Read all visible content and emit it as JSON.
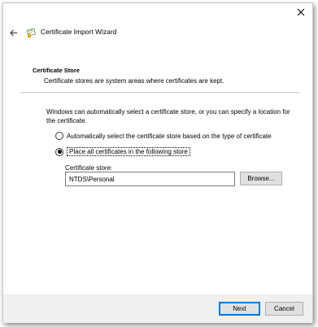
{
  "wizard": {
    "title": "Certificate Import Wizard",
    "back_icon": "arrow-left-icon",
    "close_icon": "close-icon",
    "certificate_icon": "certificate-icon"
  },
  "header": {
    "section_title": "Certificate Store",
    "section_description": "Certificate stores are system areas where certificates are kept."
  },
  "body": {
    "intro_text": "Windows can automatically select a certificate store, or you can specify a location for the certificate.",
    "radio_auto": {
      "label": "Automatically select the certificate store based on the type of certificate",
      "selected": false
    },
    "radio_manual": {
      "label": "Place all certificates in the following store",
      "selected": true
    },
    "store_label": "Certificate store:",
    "store_value": "NTDS\\Personal",
    "browse_label": "Browse..."
  },
  "footer": {
    "next_label": "Next",
    "cancel_label": "Cancel"
  }
}
